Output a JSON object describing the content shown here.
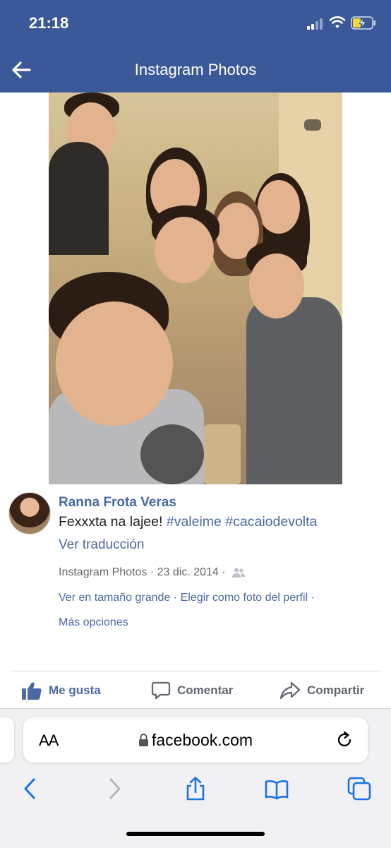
{
  "status_bar": {
    "time": "21:18"
  },
  "nav": {
    "title": "Instagram Photos"
  },
  "post": {
    "author": "Ranna Frota Veras",
    "caption_text": "Fexxxta na lajee!",
    "caption_tags": "#valeime #cacaiodevolta",
    "translate_label": "Ver traducción",
    "meta_source": "Instagram Photos",
    "meta_sep": " · ",
    "meta_date": "23 dic. 2014",
    "meta_sep2": " · ",
    "option_full_size": "Ver en tamaño grande",
    "option_sep": " · ",
    "option_profile_photo": "Elegir como foto del perfil",
    "option_sep2": " ·",
    "option_more": "Más opciones"
  },
  "actions": {
    "like_label": "Me gusta",
    "comment_label": "Comentar",
    "share_label": "Compartir"
  },
  "browser": {
    "text_size_label": "AA",
    "url": "facebook.com"
  },
  "colors": {
    "brand": "#3b5998",
    "link": "#4b69a6",
    "muted": "#65676b"
  },
  "icons": [
    "back-arrow-icon",
    "signal-icon",
    "wifi-icon",
    "battery-charging-icon",
    "friends-audience-icon",
    "like-thumb-icon",
    "comment-bubble-icon",
    "share-arrow-icon",
    "lock-icon",
    "reload-icon",
    "chevron-left-icon",
    "chevron-right-icon",
    "share-box-icon",
    "bookmarks-book-icon",
    "tabs-icon"
  ]
}
